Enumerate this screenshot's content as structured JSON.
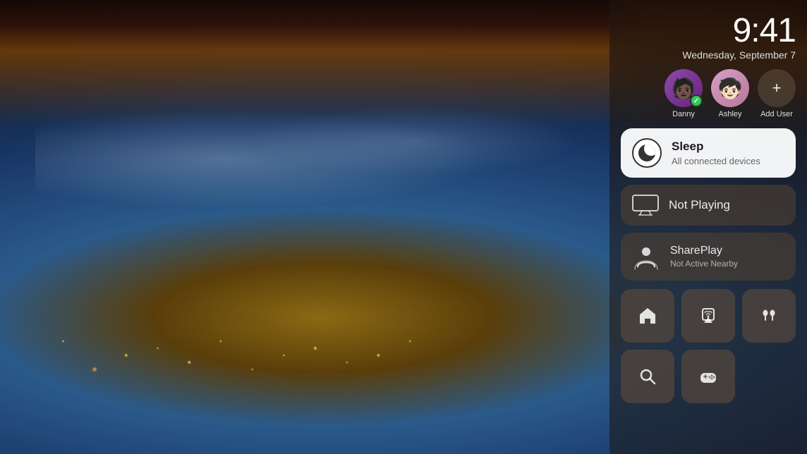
{
  "clock": {
    "time": "9:41",
    "date": "Wednesday, September 7"
  },
  "users": [
    {
      "name": "Danny",
      "emoji": "🧑🏿",
      "hasCheck": true,
      "color_start": "#8b4ca8",
      "color_end": "#6a2080"
    },
    {
      "name": "Ashley",
      "emoji": "🧑🏻",
      "hasCheck": false,
      "color_start": "#d4a0c8",
      "color_end": "#b87898"
    }
  ],
  "add_user": {
    "label": "Add User",
    "icon": "+"
  },
  "sleep_card": {
    "title": "Sleep",
    "subtitle": "All connected devices"
  },
  "not_playing_card": {
    "label": "Not Playing"
  },
  "shareplay_card": {
    "title": "SharePlay",
    "subtitle": "Not Active Nearby"
  },
  "icons": [
    {
      "name": "home-icon",
      "label": "Home"
    },
    {
      "name": "airplay-icon",
      "label": "AirPlay"
    },
    {
      "name": "airpods-icon",
      "label": "AirPods"
    },
    {
      "name": "search-icon",
      "label": "Search"
    },
    {
      "name": "gamepad-icon",
      "label": "Game Controller"
    }
  ]
}
